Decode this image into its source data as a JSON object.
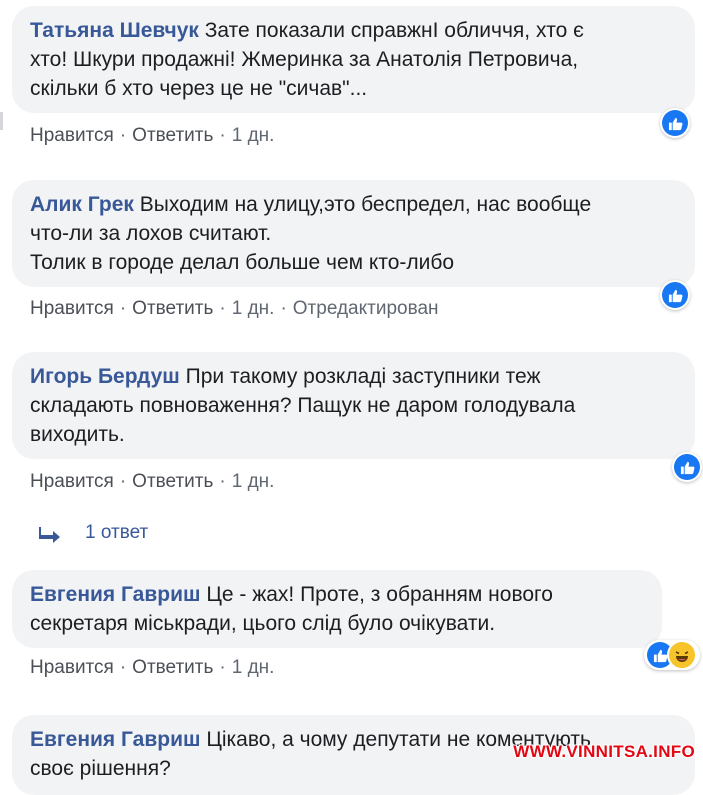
{
  "comments": [
    {
      "author": "Татьяна Шевчук",
      "text": " Зате показали справжнI обличчя, хто є\nхто! Шкури продажні! Жмеринка за Анатолія Петровича,\nскільки б хто через це не \"сичав\"...",
      "actions": {
        "like": "Нравится",
        "reply": "Ответить",
        "time": "1 дн."
      }
    },
    {
      "author": "Алик Грек",
      "text": " Выходим на улицу,это беспредел, нас вообще\nчто-ли за лохов считают.\nТолик в городе делал больше чем кто-либо",
      "actions": {
        "like": "Нравится",
        "reply": "Ответить",
        "time": "1 дн.",
        "edited": "Отредактирован"
      }
    },
    {
      "author": "Игорь Бердуш",
      "text": " При такому розкладі заступники теж\nскладають повноваження? Пащук не даром голодувала\nвиходить.",
      "actions": {
        "like": "Нравится",
        "reply": "Ответить",
        "time": "1 дн."
      },
      "replies_label": "1 ответ"
    },
    {
      "author": "Евгения Гавриш",
      "text": " Це - жах! Проте, з обранням нового\nсекретаря міськради, цього слід було очікувати.",
      "actions": {
        "like": "Нравится",
        "reply": "Ответить",
        "time": "1 дн."
      }
    },
    {
      "author": "Евгения Гавриш",
      "text": " Цікаво, а чому депутати не коментують\nсвоє рішення?"
    }
  ],
  "separator": "·",
  "watermark": "WWW.VINNITSA.INFO",
  "colors": {
    "author": "#385898",
    "like_blue": "#1877f2",
    "bubble": "#f2f3f5",
    "watermark": "#e30613"
  },
  "icons": {
    "like": "thumbs-up-icon",
    "haha": "haha-face-icon",
    "reply": "reply-arrow-icon"
  }
}
